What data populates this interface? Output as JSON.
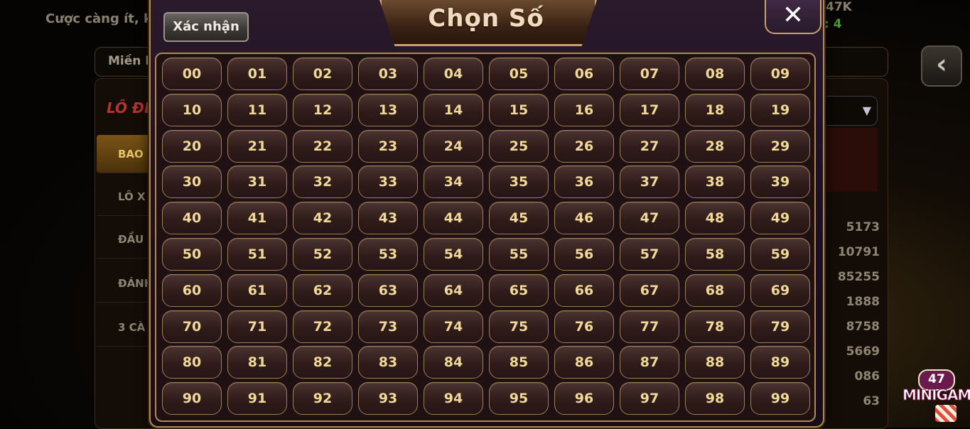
{
  "background": {
    "top_text": "Cược càng ít, k",
    "region_label": "Miền B",
    "top_right_value": "47K",
    "top_right_sub": ": 4",
    "lode_title": "LÔ ĐỀ",
    "tabs": [
      "BAO L",
      "LÔ X",
      "ĐẦU Đ",
      "ĐÁNH",
      "3 CÀ"
    ],
    "right_values": [
      "5173",
      "10791",
      "85255",
      "1888",
      "8758",
      "5669",
      "086",
      "63"
    ]
  },
  "modal": {
    "title": "Chọn Số",
    "confirm_label": "Xác nhận",
    "close_label": "✕",
    "numbers": [
      "00",
      "01",
      "02",
      "03",
      "04",
      "05",
      "06",
      "07",
      "08",
      "09",
      "10",
      "11",
      "12",
      "13",
      "14",
      "15",
      "16",
      "17",
      "18",
      "19",
      "20",
      "21",
      "22",
      "23",
      "24",
      "25",
      "26",
      "27",
      "28",
      "29",
      "30",
      "31",
      "32",
      "33",
      "34",
      "35",
      "36",
      "37",
      "38",
      "39",
      "40",
      "41",
      "42",
      "43",
      "44",
      "45",
      "46",
      "47",
      "48",
      "49",
      "50",
      "51",
      "52",
      "53",
      "54",
      "55",
      "56",
      "57",
      "58",
      "59",
      "60",
      "61",
      "62",
      "63",
      "64",
      "65",
      "66",
      "67",
      "68",
      "69",
      "70",
      "71",
      "72",
      "73",
      "74",
      "75",
      "76",
      "77",
      "78",
      "79",
      "80",
      "81",
      "82",
      "83",
      "84",
      "85",
      "86",
      "87",
      "88",
      "89",
      "90",
      "91",
      "92",
      "93",
      "94",
      "95",
      "96",
      "97",
      "98",
      "99"
    ]
  },
  "minigame": {
    "count": "47",
    "label": "MINIGAME"
  },
  "colors": {
    "accent_gold": "#b08a50",
    "number_text": "#f1d99a"
  }
}
